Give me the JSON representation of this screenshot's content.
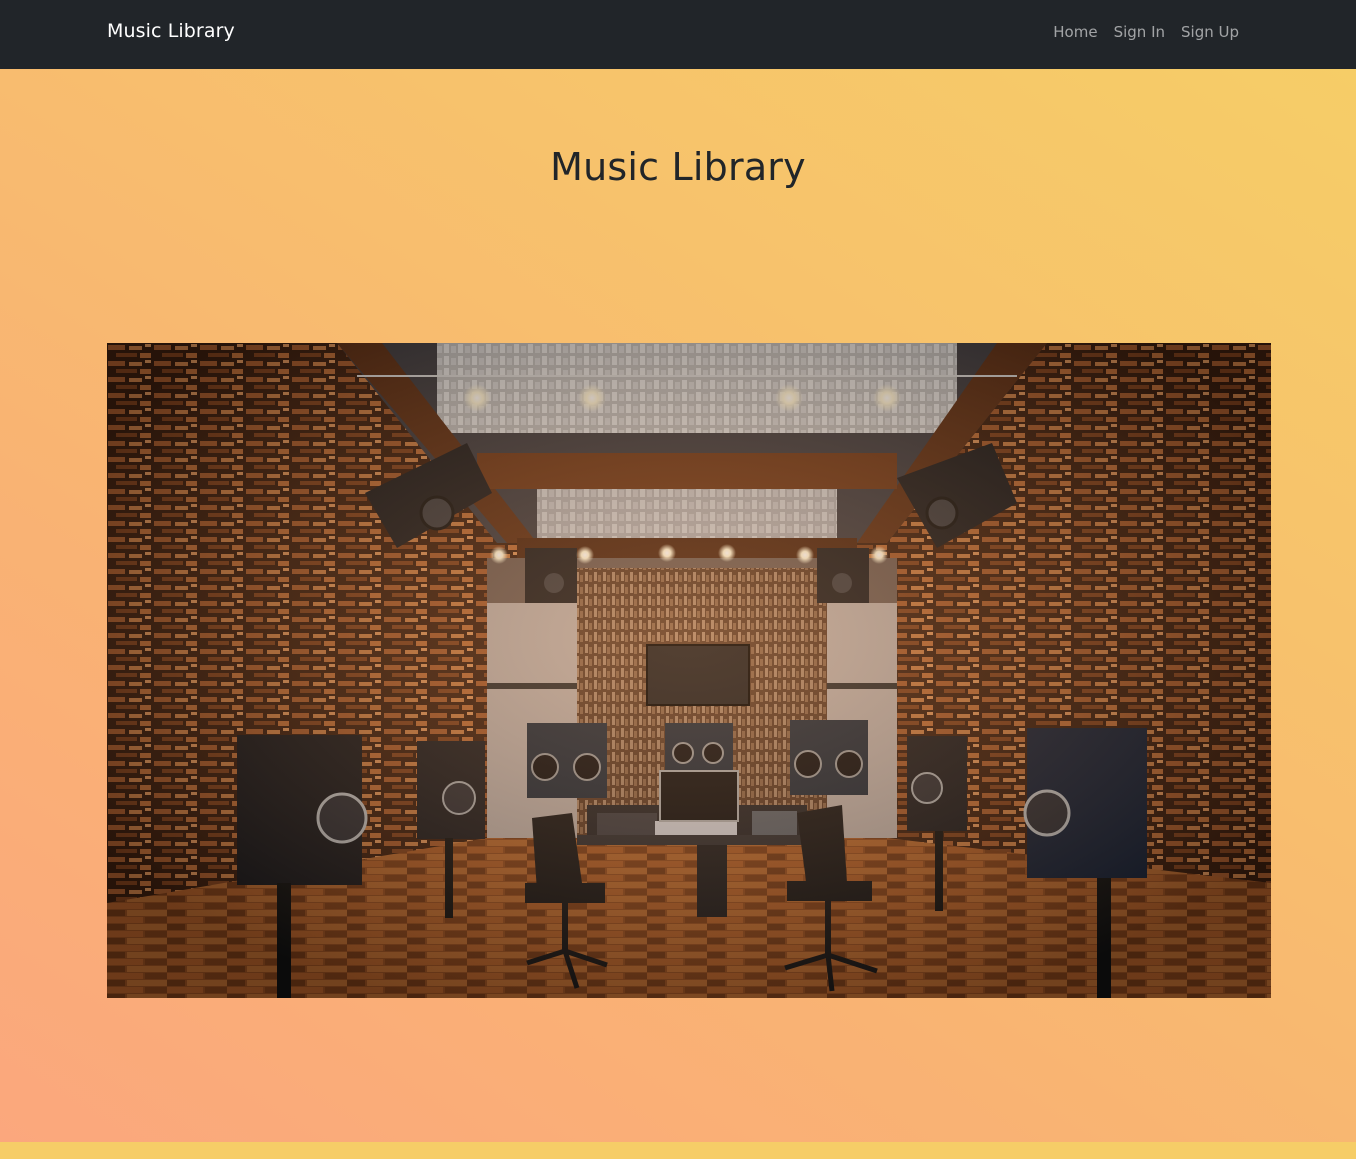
{
  "navbar": {
    "brand": "Music Library",
    "links": [
      {
        "label": "Home"
      },
      {
        "label": "Sign In"
      },
      {
        "label": "Sign Up"
      }
    ]
  },
  "hero": {
    "title": "Music Library",
    "image_subject": "recording studio control room with speakers, mixing console, laptop and two office chairs"
  },
  "colors": {
    "navbar_bg": "#212529",
    "brand_text": "#ffffff",
    "nav_link_text": "rgba(255,255,255,0.58)",
    "title_text": "#212529",
    "gradient_start": "#fba77d",
    "gradient_end": "#f6cd67"
  }
}
